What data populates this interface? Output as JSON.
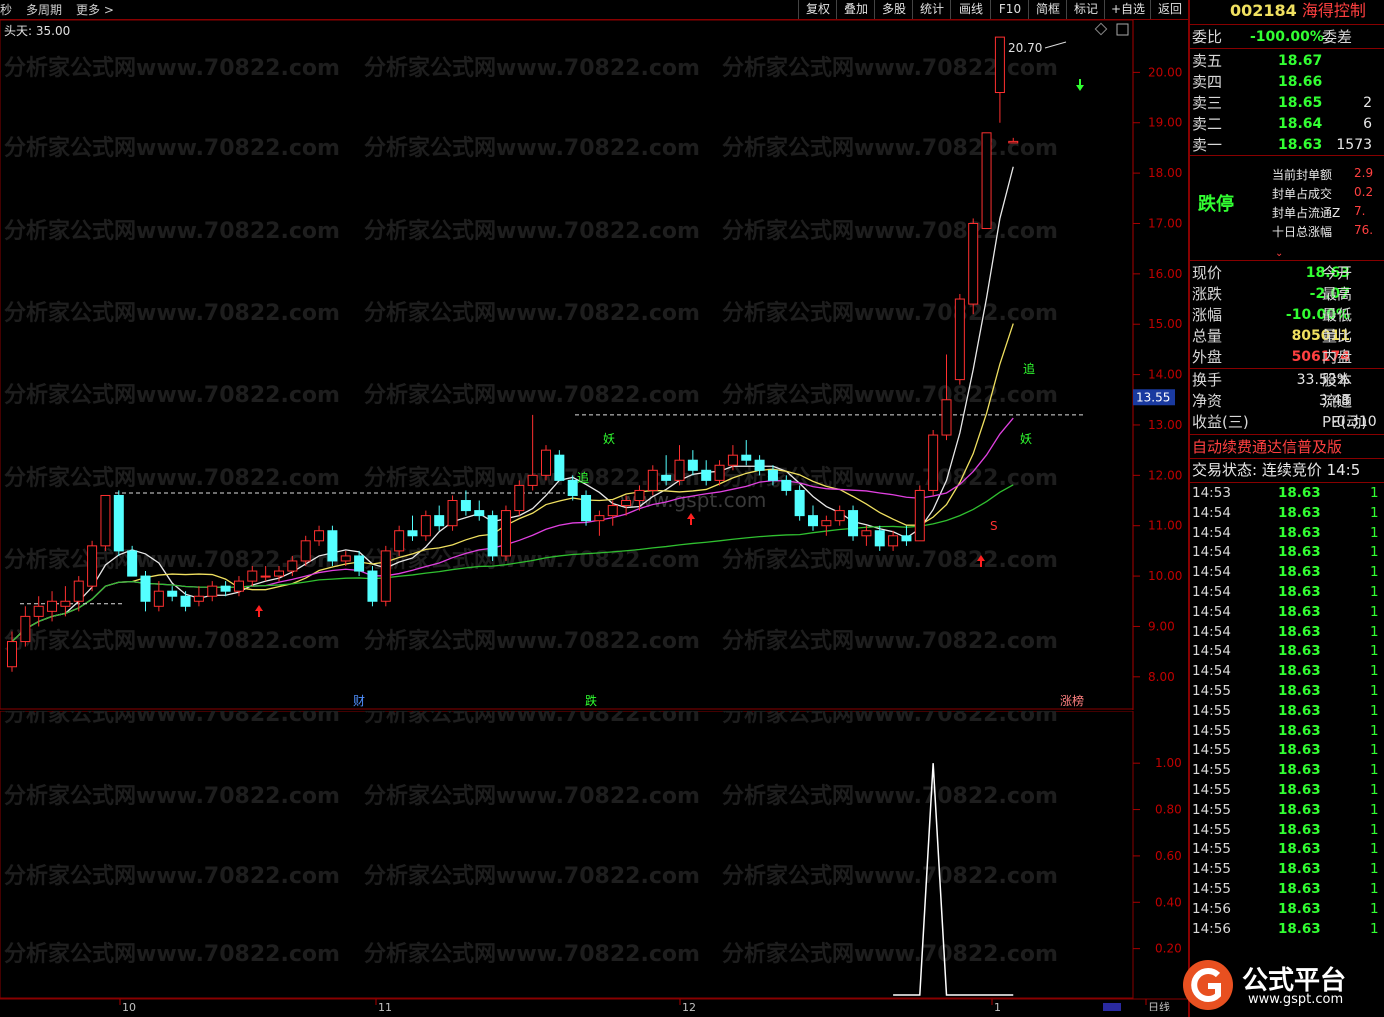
{
  "toolbar": {
    "left": [
      "秒",
      "多周期",
      "更多 >"
    ],
    "buttons": [
      "复权",
      "叠加",
      "多股",
      "统计",
      "画线",
      "F10",
      "简框",
      "标记",
      "+自选",
      "返回"
    ]
  },
  "stock": {
    "code": "002184",
    "name": "海得控制"
  },
  "indicator_title": "头天: 35.00",
  "watermark": "分析家公式网www.70822.com",
  "watermark2": "www.gspt.com",
  "price_labels": {
    "high": "20.70",
    "current": "13.55"
  },
  "markers": {
    "cai": "财",
    "die": "跌",
    "zhangbang": "涨榜",
    "yao": "妖",
    "zhui": "追",
    "s": "S"
  },
  "x_ticks": [
    "10",
    "11",
    "12",
    "1",
    "日线"
  ],
  "order_book": {
    "weibi_label": "委比",
    "weibi_value": "-100.00%",
    "weicha_label": "委差",
    "asks": [
      {
        "label": "卖五",
        "price": "18.67",
        "vol": ""
      },
      {
        "label": "卖四",
        "price": "18.66",
        "vol": ""
      },
      {
        "label": "卖三",
        "price": "18.65",
        "vol": "2"
      },
      {
        "label": "卖二",
        "price": "18.64",
        "vol": "6"
      },
      {
        "label": "卖一",
        "price": "18.63",
        "vol": "1573"
      }
    ]
  },
  "limit_box": {
    "status": "跌停",
    "items": [
      {
        "label": "当前封单额",
        "value": "2.9"
      },
      {
        "label": "封单占成交",
        "value": "0.2"
      },
      {
        "label": "封单占流通Z",
        "value": "7."
      },
      {
        "label": "十日总涨幅",
        "value": "76."
      }
    ]
  },
  "quote": [
    {
      "l1": "现价",
      "v1": "18.63",
      "c1": "g",
      "l2": "今开"
    },
    {
      "l1": "涨跌",
      "v1": "-2.07",
      "c1": "g",
      "l2": "最高"
    },
    {
      "l1": "涨幅",
      "v1": "-10.00%",
      "c1": "g",
      "l2": "最低"
    },
    {
      "l1": "总量",
      "v1": "805011",
      "c1": "y",
      "l2": "量比"
    },
    {
      "l1": "外盘",
      "v1": "506174",
      "c1": "r",
      "l2": "内盘"
    },
    {
      "l1": "换手",
      "v1": "33.53%",
      "c1": "w",
      "l2": "股本"
    },
    {
      "l1": "净资",
      "v1": "3.48",
      "c1": "w",
      "l2": "流通"
    },
    {
      "l1": "收益(三)",
      "v1": "-0.310",
      "c1": "w",
      "l2": "PE(动)"
    }
  ],
  "ad_text": "自动续费通达信普及版",
  "trade_status": "交易状态: 连续竞价 14:5",
  "ticks": [
    {
      "t": "14:53",
      "p": "18.63",
      "v": "1"
    },
    {
      "t": "14:54",
      "p": "18.63",
      "v": "1"
    },
    {
      "t": "14:54",
      "p": "18.63",
      "v": "1"
    },
    {
      "t": "14:54",
      "p": "18.63",
      "v": "1"
    },
    {
      "t": "14:54",
      "p": "18.63",
      "v": "1"
    },
    {
      "t": "14:54",
      "p": "18.63",
      "v": "1"
    },
    {
      "t": "14:54",
      "p": "18.63",
      "v": "1"
    },
    {
      "t": "14:54",
      "p": "18.63",
      "v": "1"
    },
    {
      "t": "14:54",
      "p": "18.63",
      "v": "1"
    },
    {
      "t": "14:54",
      "p": "18.63",
      "v": "1"
    },
    {
      "t": "14:55",
      "p": "18.63",
      "v": "1"
    },
    {
      "t": "14:55",
      "p": "18.63",
      "v": "1"
    },
    {
      "t": "14:55",
      "p": "18.63",
      "v": "1"
    },
    {
      "t": "14:55",
      "p": "18.63",
      "v": "1"
    },
    {
      "t": "14:55",
      "p": "18.63",
      "v": "1"
    },
    {
      "t": "14:55",
      "p": "18.63",
      "v": "1"
    },
    {
      "t": "14:55",
      "p": "18.63",
      "v": "1"
    },
    {
      "t": "14:55",
      "p": "18.63",
      "v": "1"
    },
    {
      "t": "14:55",
      "p": "18.63",
      "v": "1"
    },
    {
      "t": "14:55",
      "p": "18.63",
      "v": "1"
    },
    {
      "t": "14:55",
      "p": "18.63",
      "v": "1"
    },
    {
      "t": "14:56",
      "p": "18.63",
      "v": "1"
    },
    {
      "t": "14:56",
      "p": "18.63",
      "v": "1"
    }
  ],
  "logo": {
    "text": "公式平台",
    "url": "www.gspt.com"
  },
  "chart_data": [
    {
      "type": "candlestick",
      "y_ticks": [
        "20.00",
        "19.00",
        "18.00",
        "17.00",
        "16.00",
        "15.00",
        "14.00",
        "13.00",
        "12.00",
        "11.00",
        "10.00",
        "9.00",
        "8.00"
      ],
      "ylim": [
        7.5,
        21.0
      ],
      "candles": [
        [
          8.2,
          8.9,
          8.1,
          8.7
        ],
        [
          8.7,
          9.4,
          8.6,
          9.2
        ],
        [
          9.2,
          9.6,
          9.0,
          9.4
        ],
        [
          9.3,
          9.7,
          9.1,
          9.5
        ],
        [
          9.4,
          9.8,
          9.2,
          9.5
        ],
        [
          9.5,
          10.0,
          9.3,
          9.9
        ],
        [
          9.8,
          10.7,
          9.7,
          10.6
        ],
        [
          10.6,
          11.6,
          10.5,
          11.6
        ],
        [
          11.6,
          11.7,
          10.4,
          10.5
        ],
        [
          10.5,
          10.6,
          10.0,
          10.0
        ],
        [
          10.0,
          10.1,
          9.3,
          9.5
        ],
        [
          9.4,
          9.9,
          9.3,
          9.7
        ],
        [
          9.7,
          9.8,
          9.5,
          9.6
        ],
        [
          9.6,
          9.7,
          9.3,
          9.4
        ],
        [
          9.5,
          9.8,
          9.4,
          9.6
        ],
        [
          9.6,
          9.9,
          9.5,
          9.8
        ],
        [
          9.8,
          9.9,
          9.6,
          9.7
        ],
        [
          9.7,
          10.0,
          9.6,
          9.9
        ],
        [
          9.9,
          10.2,
          9.8,
          10.1
        ],
        [
          10.0,
          10.2,
          9.9,
          10.0
        ],
        [
          10.0,
          10.2,
          9.9,
          10.1
        ],
        [
          10.1,
          10.4,
          10.0,
          10.3
        ],
        [
          10.3,
          10.8,
          10.2,
          10.7
        ],
        [
          10.7,
          11.0,
          10.6,
          10.9
        ],
        [
          10.9,
          11.0,
          10.2,
          10.3
        ],
        [
          10.3,
          10.5,
          10.2,
          10.4
        ],
        [
          10.4,
          10.5,
          10.0,
          10.1
        ],
        [
          10.1,
          10.2,
          9.4,
          9.5
        ],
        [
          9.5,
          10.6,
          9.4,
          10.5
        ],
        [
          10.5,
          11.0,
          10.4,
          10.9
        ],
        [
          10.9,
          11.2,
          10.7,
          10.8
        ],
        [
          10.8,
          11.3,
          10.7,
          11.2
        ],
        [
          11.2,
          11.4,
          10.9,
          11.0
        ],
        [
          11.0,
          11.6,
          10.9,
          11.5
        ],
        [
          11.5,
          11.7,
          11.2,
          11.3
        ],
        [
          11.3,
          11.5,
          11.1,
          11.2
        ],
        [
          11.2,
          11.3,
          10.3,
          10.4
        ],
        [
          10.4,
          11.4,
          10.3,
          11.3
        ],
        [
          11.3,
          11.9,
          11.2,
          11.8
        ],
        [
          11.8,
          13.2,
          11.7,
          12.0
        ],
        [
          12.0,
          12.6,
          11.9,
          12.5
        ],
        [
          12.4,
          12.5,
          11.9,
          11.9
        ],
        [
          11.9,
          12.0,
          11.5,
          11.6
        ],
        [
          11.6,
          11.7,
          11.0,
          11.1
        ],
        [
          11.1,
          11.3,
          10.8,
          11.2
        ],
        [
          11.2,
          11.5,
          11.0,
          11.4
        ],
        [
          11.4,
          11.6,
          11.2,
          11.5
        ],
        [
          11.5,
          11.8,
          11.3,
          11.7
        ],
        [
          11.7,
          12.2,
          11.6,
          12.1
        ],
        [
          12.0,
          12.4,
          11.8,
          11.9
        ],
        [
          11.9,
          12.6,
          11.8,
          12.3
        ],
        [
          12.3,
          12.5,
          12.0,
          12.1
        ],
        [
          12.1,
          12.3,
          11.8,
          11.9
        ],
        [
          11.9,
          12.3,
          11.8,
          12.2
        ],
        [
          12.2,
          12.6,
          12.1,
          12.4
        ],
        [
          12.4,
          12.7,
          12.2,
          12.3
        ],
        [
          12.3,
          12.4,
          12.0,
          12.1
        ],
        [
          12.1,
          12.2,
          11.8,
          11.9
        ],
        [
          11.9,
          12.0,
          11.6,
          11.7
        ],
        [
          11.7,
          11.8,
          11.1,
          11.2
        ],
        [
          11.2,
          11.4,
          10.9,
          11.0
        ],
        [
          11.0,
          11.2,
          10.8,
          11.1
        ],
        [
          11.1,
          11.4,
          11.0,
          11.3
        ],
        [
          11.3,
          11.4,
          10.7,
          10.8
        ],
        [
          10.8,
          11.0,
          10.6,
          10.9
        ],
        [
          10.9,
          11.0,
          10.5,
          10.6
        ],
        [
          10.6,
          10.9,
          10.5,
          10.8
        ],
        [
          10.8,
          11.0,
          10.6,
          10.7
        ],
        [
          10.7,
          11.8,
          10.7,
          11.7
        ],
        [
          11.7,
          12.9,
          11.6,
          12.8
        ],
        [
          12.8,
          14.4,
          12.7,
          13.5
        ],
        [
          13.9,
          15.6,
          13.8,
          15.5
        ],
        [
          15.4,
          17.1,
          15.2,
          17.0
        ],
        [
          16.9,
          18.8,
          16.9,
          18.8
        ],
        [
          19.6,
          20.7,
          19.0,
          20.7
        ],
        [
          18.6,
          18.7,
          18.6,
          18.63
        ]
      ]
    },
    {
      "type": "line",
      "y_ticks": [
        "1.00",
        "0.80",
        "0.60",
        "0.40",
        "0.20"
      ],
      "ylim": [
        0,
        1.1
      ],
      "values": [
        0,
        0,
        0,
        0,
        0,
        0,
        0,
        0,
        0,
        0,
        0,
        0,
        0,
        0,
        0,
        0,
        0,
        0,
        0,
        0,
        0,
        0,
        0,
        0,
        0,
        0,
        0,
        0,
        0,
        0,
        0,
        0,
        0,
        0,
        0,
        0,
        0,
        0,
        0,
        0,
        0,
        0,
        0,
        0,
        0,
        0,
        0,
        0,
        0,
        0,
        0,
        0,
        0,
        0,
        0,
        0,
        0,
        0,
        0,
        0,
        0,
        0,
        0,
        0,
        0,
        0,
        0,
        0,
        0,
        1,
        0,
        0,
        0,
        0,
        0,
        0
      ]
    }
  ]
}
